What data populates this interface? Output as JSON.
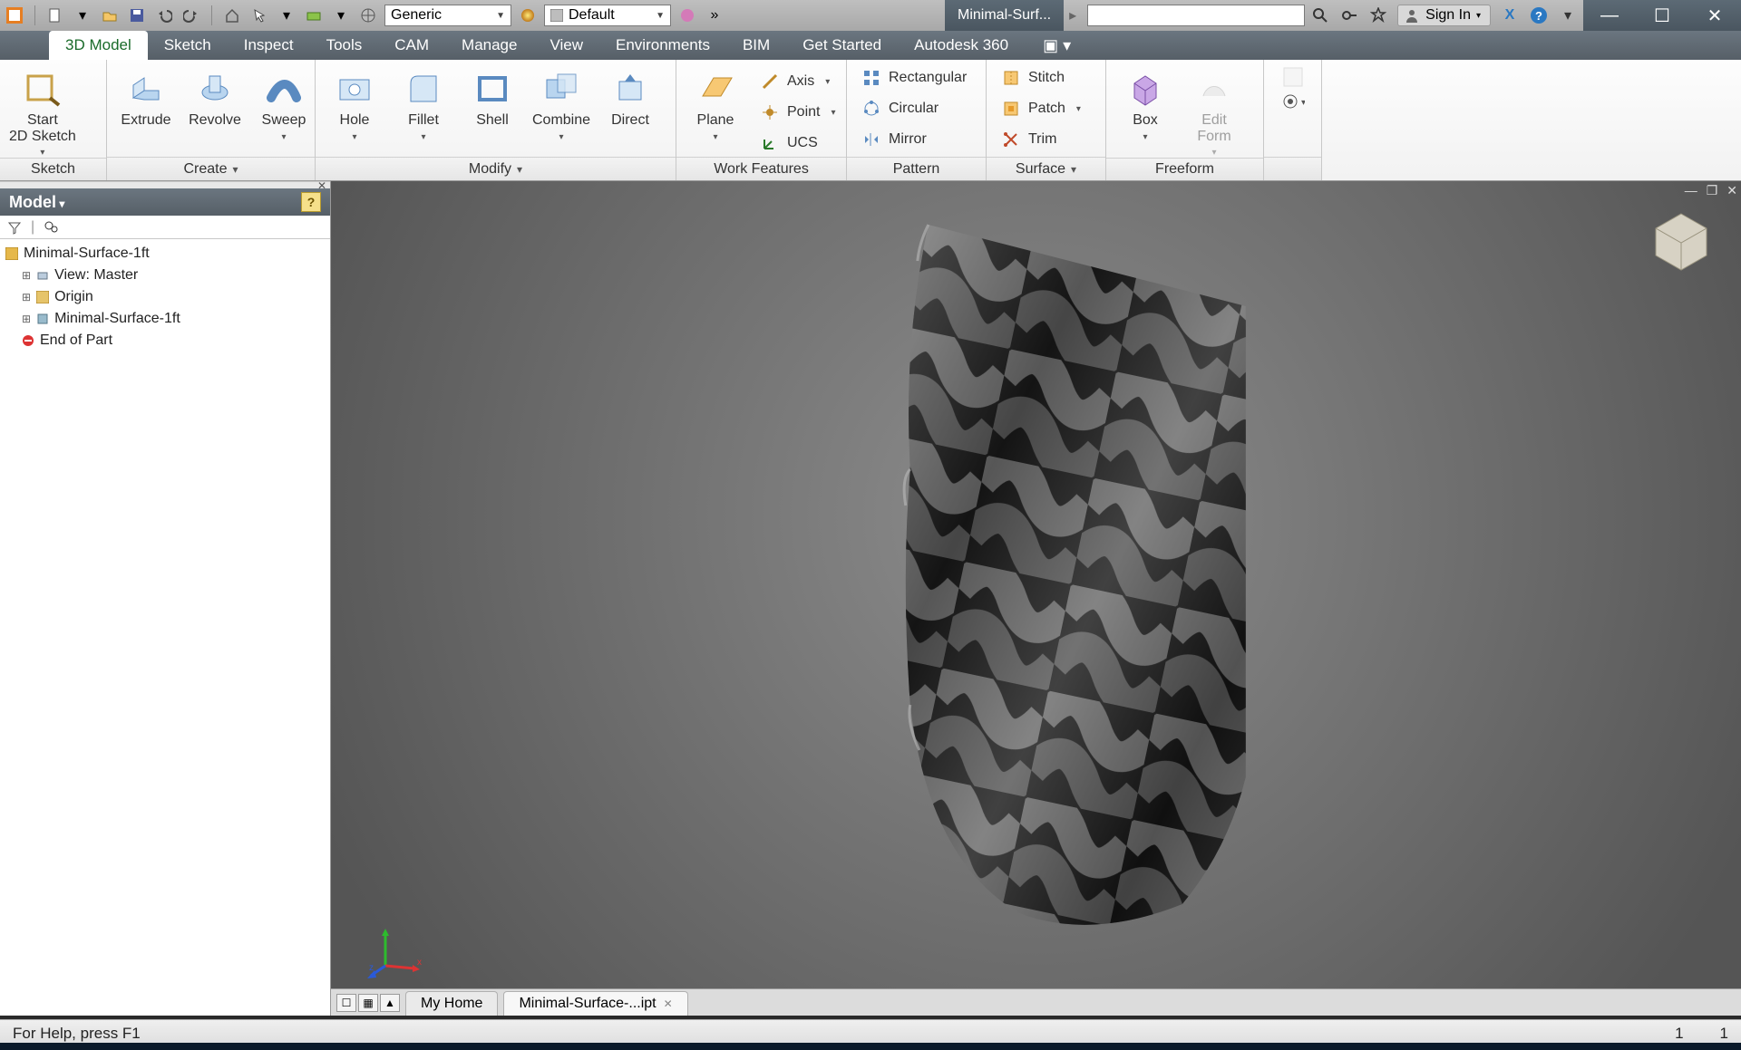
{
  "qat": {
    "material_combo": "Generic",
    "appearance_combo": "Default"
  },
  "title_tab": "Minimal-Surf...",
  "search_placeholder": "",
  "signin": "Sign In",
  "ribbon_tabs": [
    "3D Model",
    "Sketch",
    "Inspect",
    "Tools",
    "CAM",
    "Manage",
    "View",
    "Environments",
    "BIM",
    "Get Started",
    "Autodesk 360"
  ],
  "panels": {
    "sketch": {
      "title": "Sketch",
      "start": "Start\n2D Sketch"
    },
    "create": {
      "title": "Create",
      "extrude": "Extrude",
      "revolve": "Revolve",
      "sweep": "Sweep"
    },
    "modify": {
      "title": "Modify",
      "hole": "Hole",
      "fillet": "Fillet",
      "shell": "Shell",
      "combine": "Combine",
      "direct": "Direct"
    },
    "work": {
      "title": "Work Features",
      "plane": "Plane",
      "axis": "Axis",
      "point": "Point",
      "ucs": "UCS"
    },
    "pattern": {
      "title": "Pattern",
      "rect": "Rectangular",
      "circ": "Circular",
      "mirror": "Mirror"
    },
    "surface": {
      "title": "Surface",
      "stitch": "Stitch",
      "patch": "Patch",
      "trim": "Trim"
    },
    "freeform": {
      "title": "Freeform",
      "box": "Box",
      "edit": "Edit\nForm"
    }
  },
  "browser": {
    "title": "Model",
    "root": "Minimal-Surface-1ft",
    "view": "View: Master",
    "origin": "Origin",
    "feat": "Minimal-Surface-1ft",
    "end": "End of Part"
  },
  "doc_tabs": {
    "home": "My Home",
    "file": "Minimal-Surface-...ipt"
  },
  "status": {
    "help": "For Help, press F1",
    "a": "1",
    "b": "1"
  }
}
